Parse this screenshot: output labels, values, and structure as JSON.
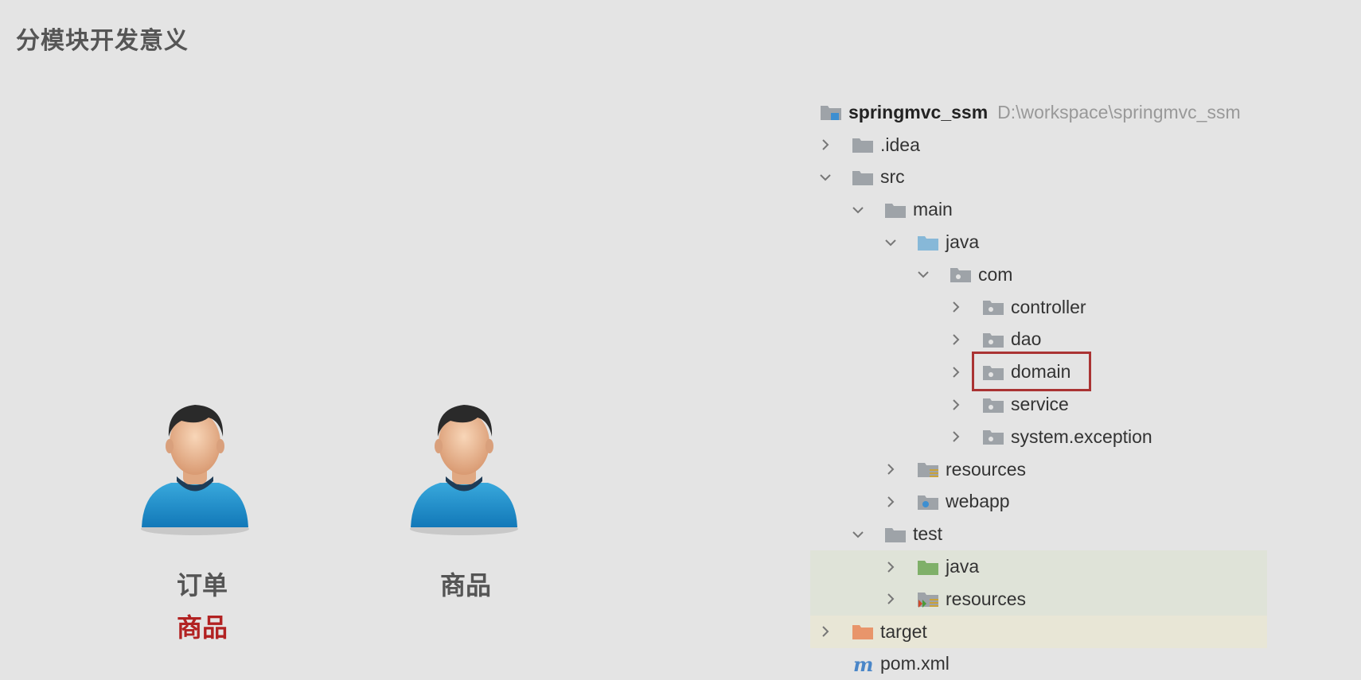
{
  "slide": {
    "title": "分模块开发意义"
  },
  "people": [
    {
      "label": "订单",
      "sublabel": "商品"
    },
    {
      "label": "商品",
      "sublabel": ""
    }
  ],
  "tree": {
    "root": {
      "name": "springmvc_ssm",
      "path": "D:\\workspace\\springmvc_ssm"
    },
    "items": [
      {
        "name": ".idea",
        "expanded": false,
        "icon": "folder-icon"
      },
      {
        "name": "src",
        "expanded": true,
        "icon": "folder-icon"
      },
      {
        "name": "main",
        "expanded": true,
        "icon": "folder-icon"
      },
      {
        "name": "java",
        "expanded": true,
        "icon": "source-folder-icon"
      },
      {
        "name": "com",
        "expanded": true,
        "icon": "package-icon"
      },
      {
        "name": "controller",
        "expanded": false,
        "icon": "package-icon"
      },
      {
        "name": "dao",
        "expanded": false,
        "icon": "package-icon"
      },
      {
        "name": "domain",
        "expanded": false,
        "icon": "package-icon",
        "highlighted": true
      },
      {
        "name": "service",
        "expanded": false,
        "icon": "package-icon"
      },
      {
        "name": "system.exception",
        "expanded": false,
        "icon": "package-icon"
      },
      {
        "name": "resources",
        "expanded": false,
        "icon": "resources-folder-icon"
      },
      {
        "name": "webapp",
        "expanded": false,
        "icon": "web-folder-icon"
      },
      {
        "name": "test",
        "expanded": true,
        "icon": "folder-icon"
      },
      {
        "name": "java",
        "expanded": false,
        "icon": "test-source-folder-icon"
      },
      {
        "name": "resources",
        "expanded": false,
        "icon": "test-resources-folder-icon"
      },
      {
        "name": "target",
        "expanded": false,
        "icon": "excluded-folder-icon"
      },
      {
        "name": "pom.xml",
        "expanded": false,
        "icon": "maven-icon"
      }
    ]
  },
  "colors": {
    "highlight_border": "#aa3333",
    "sublabel": "#b22222",
    "folder": "#9ea3a8",
    "source_folder": "#87b8d8",
    "test_folder": "#7fb069",
    "excluded_folder": "#e8956b",
    "maven": "#4a86c8"
  }
}
